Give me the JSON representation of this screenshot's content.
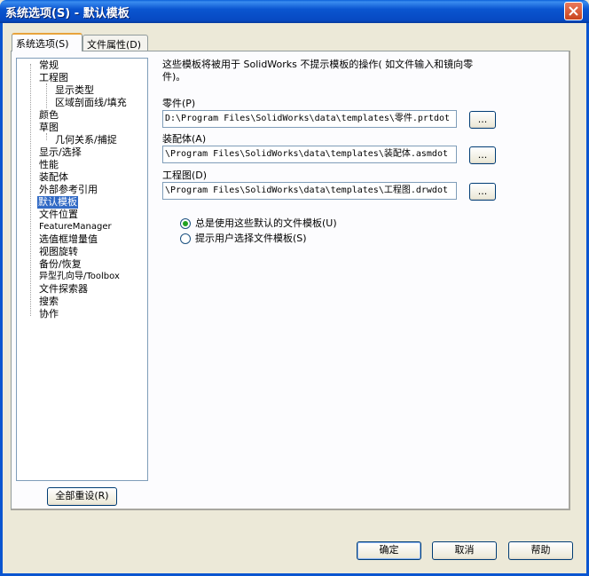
{
  "window": {
    "title": "系统选项(S) - 默认模板"
  },
  "tabs": [
    {
      "label": "系统选项(S)",
      "active": true
    },
    {
      "label": "文件属性(D)",
      "active": false
    }
  ],
  "tree": {
    "items": [
      "常规",
      "工程图",
      "显示类型",
      "区域剖面线/填充",
      "颜色",
      "草图",
      "几何关系/捕捉",
      "显示/选择",
      "性能",
      "装配体",
      "外部参考引用",
      "默认模板",
      "文件位置",
      "FeatureManager",
      "选值框增量值",
      "视图旋转",
      "备份/恢复",
      "异型孔向导/Toolbox",
      "文件探索器",
      "搜索",
      "协作"
    ],
    "selected": "默认模板"
  },
  "reset_button": "全部重设(R)",
  "content": {
    "description": "这些模板将被用于 SolidWorks 不提示模板的操作( 如文件输入和镜向零件)。",
    "part": {
      "label": "零件(P)",
      "value": "D:\\Program Files\\SolidWorks\\data\\templates\\零件.prtdot"
    },
    "assembly": {
      "label": "装配体(A)",
      "value": "\\Program Files\\SolidWorks\\data\\templates\\装配体.asmdot"
    },
    "drawing": {
      "label": "工程图(D)",
      "value": "\\Program Files\\SolidWorks\\data\\templates\\工程图.drwdot"
    },
    "browse_label": "...",
    "radio_always": "总是使用这些默认的文件模板(U)",
    "radio_prompt": "提示用户选择文件模板(S)",
    "radio_selected": "always"
  },
  "footer": {
    "ok": "确定",
    "cancel": "取消",
    "help": "帮助"
  },
  "colors": {
    "title_bar": "#0a55d0",
    "selection": "#316ac5",
    "dialog_bg": "#ece9d8"
  }
}
